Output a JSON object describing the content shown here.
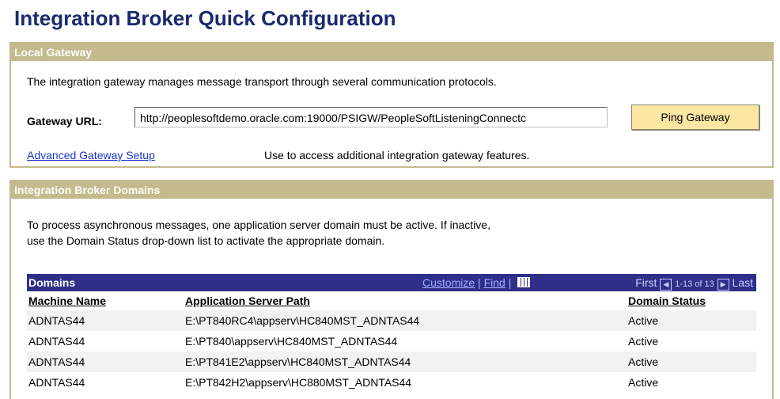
{
  "page_title": "Integration Broker Quick Configuration",
  "local_gateway": {
    "header": "Local Gateway",
    "description": "The integration gateway manages message transport through several communication protocols.",
    "gateway_url_label": "Gateway URL:",
    "gateway_url_value": "http://peoplesoftdemo.oracle.com:19000/PSIGW/PeopleSoftListeningConnectc",
    "ping_button": "Ping Gateway",
    "advanced_link": "Advanced Gateway Setup",
    "advanced_description": "Use to access additional integration gateway features."
  },
  "domains_section": {
    "header": "Integration Broker Domains",
    "description_line1": "To process asynchronous messages, one application server domain must be active. If inactive,",
    "description_line2": "use the Domain Status drop-down list to activate the appropriate domain.",
    "grid": {
      "title": "Domains",
      "customize": "Customize",
      "separator": "|",
      "find": "Find",
      "first": "First",
      "range": "1-13 of 13",
      "last": "Last",
      "columns": [
        "Machine Name",
        "Application Server Path",
        "Domain Status"
      ],
      "rows": [
        [
          "ADNTAS44",
          "E:\\PT840RC4\\appserv\\HC840MST_ADNTAS44",
          "Active"
        ],
        [
          "ADNTAS44",
          "E:\\PT840\\appserv\\HC840MST_ADNTAS44",
          "Active"
        ],
        [
          "ADNTAS44",
          "E:\\PT841E2\\appserv\\HC840MST_ADNTAS44",
          "Active"
        ],
        [
          "ADNTAS44",
          "E:\\PT842H2\\appserv\\HC880MST_ADNTAS44",
          "Active"
        ]
      ]
    }
  }
}
